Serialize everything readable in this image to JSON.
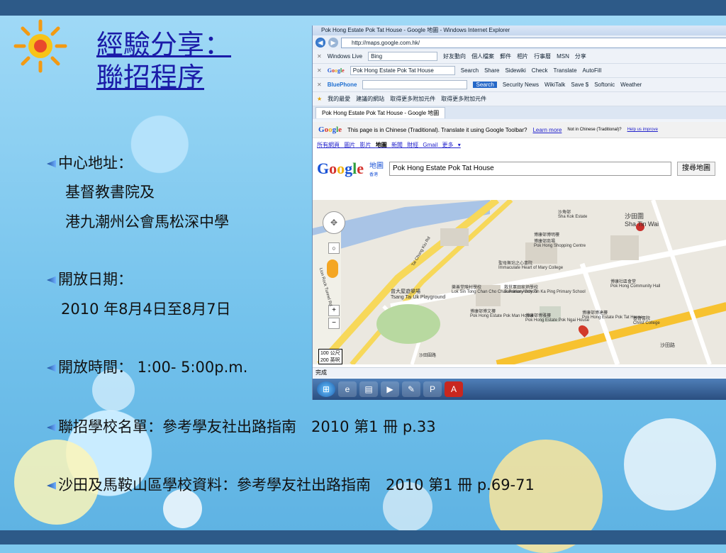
{
  "slide": {
    "title_line1": "經驗分享：",
    "title_line2": "聯招程序",
    "items": [
      {
        "label": "中心地址：",
        "lines": [
          "基督教書院及",
          "港九潮州公會馬松深中學"
        ]
      },
      {
        "label": "開放日期：",
        "lines": [
          "2010 年8月4日至8月7日"
        ]
      },
      {
        "label": "開放時間： 1:00- 5:00p.m.",
        "lines": []
      },
      {
        "label": "聯招學校名單：參考學友社出路指南　2010 第1 冊 p.33",
        "lines": []
      },
      {
        "label": "沙田及馬鞍山區學校資料：參考學友社出路指南　2010 第1 冊 p.69-71",
        "lines": []
      }
    ]
  },
  "browser": {
    "window_title": "Pok Hong Estate Pok Tat House - Google 地圖 - Windows Internet Explorer",
    "url": "http://maps.google.com.hk/",
    "toolbar1": {
      "label": "Windows Live",
      "input": "Bing",
      "links": [
        "好友動向",
        "個人檔案",
        "郵件",
        "相片",
        "行事曆",
        "MSN",
        "分享"
      ]
    },
    "toolbar2": {
      "input": "Pok Hong Estate Pok Tat House",
      "items": [
        "Search",
        "Share",
        "Sidewiki",
        "Check",
        "Translate",
        "AutoFill"
      ]
    },
    "toolbar3": {
      "brand": "BluePhone",
      "search_btn": "Search",
      "items": [
        "Security News",
        "WikiTalk",
        "Save $",
        "Softonic",
        "Weather"
      ]
    },
    "favorites": [
      "我的最愛",
      "建議的網站",
      "取得更多附加元件",
      "取得更多附加元件"
    ],
    "tab_title": "Pok Hong Estate Pok Tat House - Google 地圖",
    "translate_bar": {
      "text": "This page is in Chinese (Traditional).  Translate it using Google Toolbar?",
      "link1": "Learn more",
      "note": "Not in Chinese (Traditional)?",
      "link2": "Help us improve"
    },
    "nav_links": [
      "所有網頁",
      "圖片",
      "影片",
      "地圖",
      "新聞",
      "財經",
      "Gmail",
      "更多 ▾"
    ],
    "maps_label": "地圖",
    "maps_sub": "香港",
    "search_value": "Pok Hong Estate Pok Tat House",
    "search_button": "搜尋地圖",
    "scale": [
      "100 公尺",
      "200 英呎"
    ],
    "status": "完成",
    "map_labels": [
      "沙田圍",
      "Sha Tin Wai",
      "博康邨博明樓",
      "博康邨商場",
      "Pok Hong Shopping Centre",
      "曾大屋遊樂場",
      "Tsang Tai Uk Playground",
      "沙角邨",
      "Sha Kok Estate",
      "Tai Chung Kiu Rd",
      "Lion Rock Tunnel Rd",
      "沙田圍路",
      "博康邨博達樓",
      "Pok Hong Estate Pok Tat House",
      "博康邨博文樓",
      "Pok Hong Estate Pok Man House",
      "博康邨博雅樓",
      "Pok Hong Estate Pok Ngai House",
      "博康社區會堂",
      "Pok Hong Community Hall",
      "基督書院",
      "Christ College",
      "沙田路",
      "救世軍田家炳學校",
      "Salvation Army Tin Ka Ping Primary School",
      "樂善堂陳村學校",
      "Lok Sin Tong Chan Cho Chak Primary School",
      "聖母無玷之心書院",
      "Immaculate Heart of Mary College"
    ]
  }
}
